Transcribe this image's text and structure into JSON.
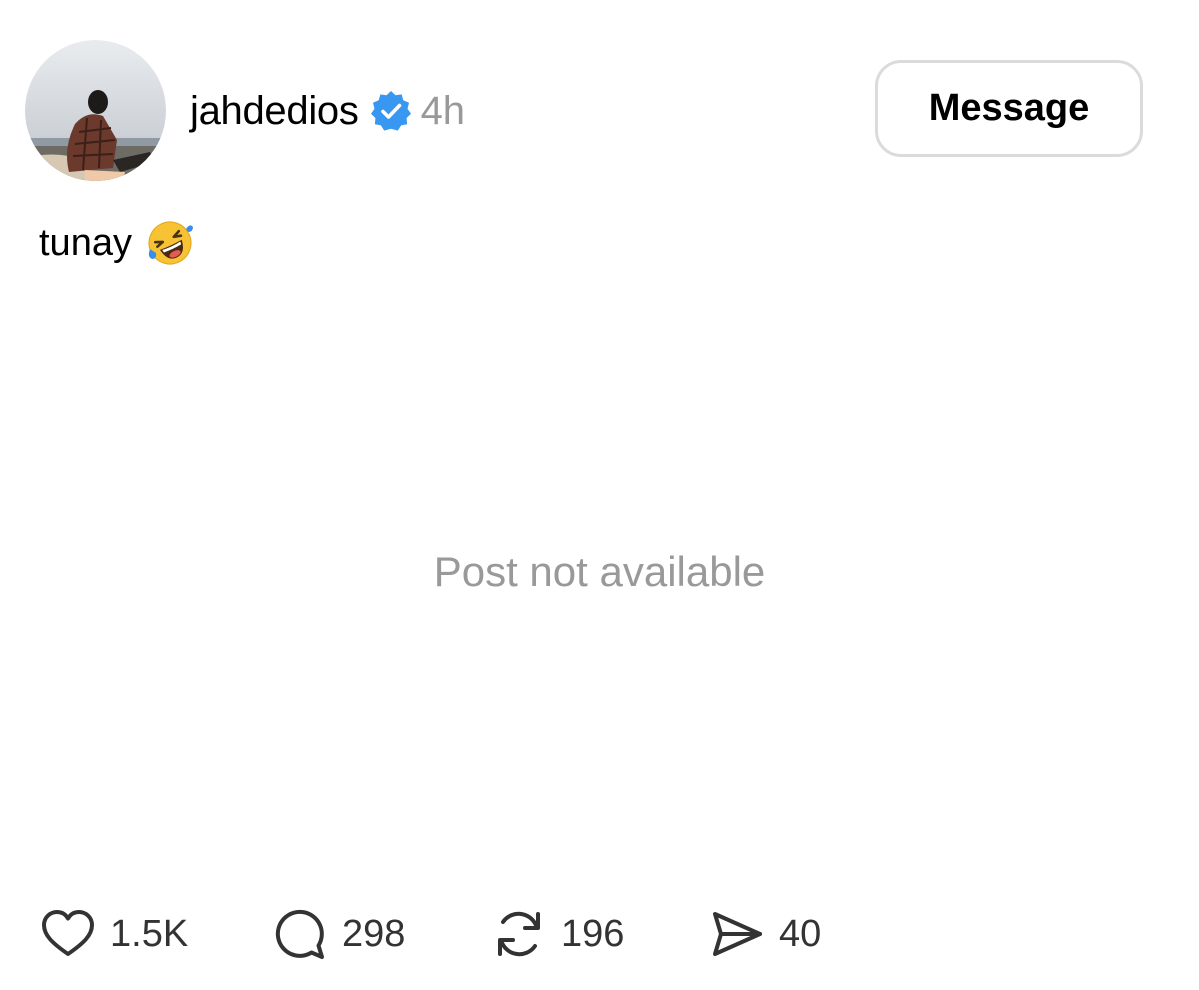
{
  "post": {
    "username": "jahdedios",
    "verified": true,
    "time": "4h",
    "caption": "tunay",
    "caption_emoji": "rolling-on-the-floor-laughing-emoji",
    "unavailable_text": "Post not available"
  },
  "header": {
    "message_label": "Message"
  },
  "actions": {
    "likes": "1.5K",
    "comments": "298",
    "reposts": "196",
    "shares": "40"
  },
  "icons": {
    "like": "heart-icon",
    "comment": "comment-bubble-icon",
    "repost": "repost-icon",
    "share": "paper-plane-icon",
    "verified": "verified-badge-icon"
  },
  "colors": {
    "verified_blue": "#3897f0",
    "muted_text": "#999999",
    "button_border": "#dbdbdb"
  }
}
